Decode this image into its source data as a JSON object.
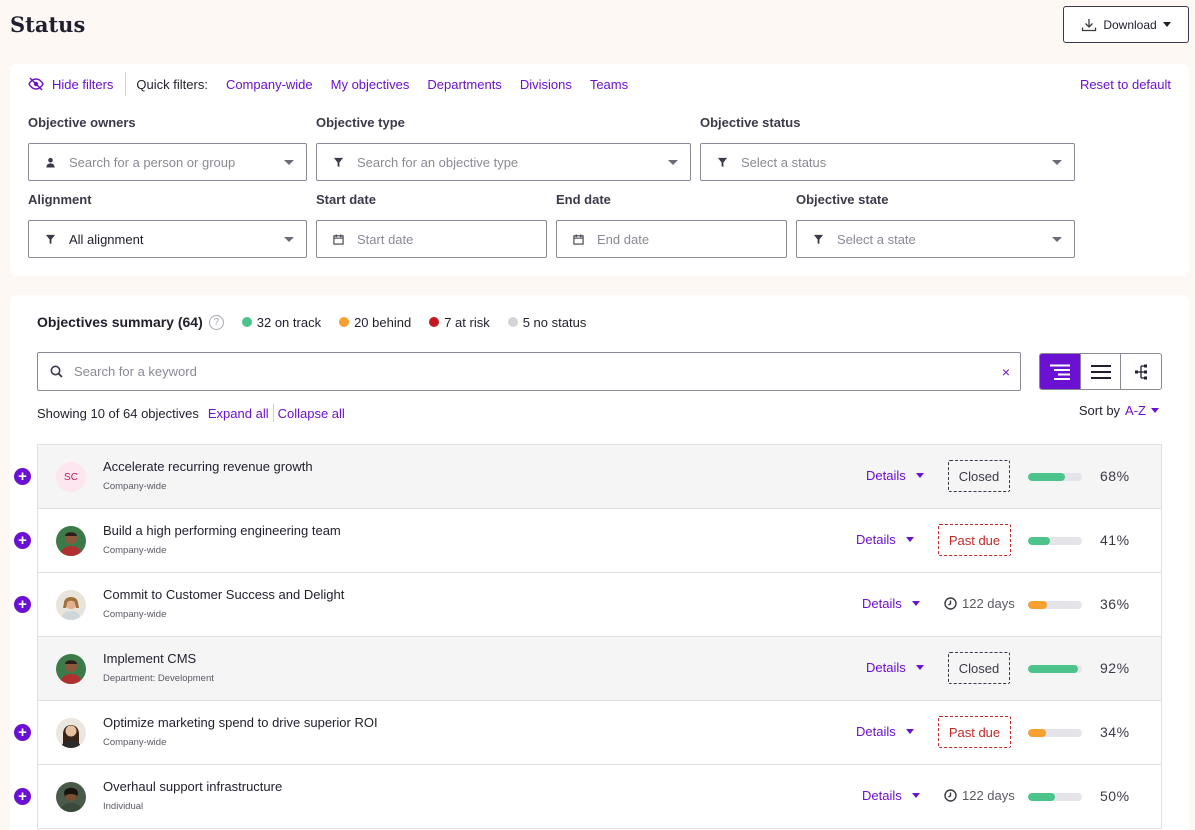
{
  "header": {
    "title": "Status",
    "download_label": "Download"
  },
  "filters": {
    "hide_label": "Hide filters",
    "quick_label": "Quick filters:",
    "quick_links": [
      "Company-wide",
      "My objectives",
      "Departments",
      "Divisions",
      "Teams"
    ],
    "reset_label": "Reset to default",
    "owners": {
      "label": "Objective owners",
      "placeholder": "Search for a person or group"
    },
    "type": {
      "label": "Objective type",
      "placeholder": "Search for an objective type"
    },
    "status": {
      "label": "Objective status",
      "placeholder": "Select a status"
    },
    "alignment": {
      "label": "Alignment",
      "value": "All alignment"
    },
    "start_date": {
      "label": "Start date",
      "placeholder": "Start date"
    },
    "end_date": {
      "label": "End date",
      "placeholder": "End date"
    },
    "state": {
      "label": "Objective state",
      "placeholder": "Select a state"
    }
  },
  "summary": {
    "title": "Objectives summary (64)",
    "help": "?",
    "stats": [
      {
        "label": "32 on track",
        "color": "#4cc38a"
      },
      {
        "label": "20 behind",
        "color": "#f5a031"
      },
      {
        "label": "7 at risk",
        "color": "#c3171e"
      },
      {
        "label": "5 no status",
        "color": "#d3d3da"
      }
    ],
    "search_placeholder": "Search for a keyword",
    "clear": "×",
    "showing": "Showing 10 of 64 objectives",
    "expand_all": "Expand all",
    "collapse_all": "Collapse all",
    "sort_label": "Sort by",
    "sort_value": "A-Z"
  },
  "objectives": [
    {
      "title": "Accelerate recurring revenue growth",
      "sub": "Company-wide",
      "avatar": "SC",
      "details": "Details",
      "badge": "Closed",
      "badge_type": "closed",
      "progress": 0.68,
      "progress_color": "#4cc38a",
      "pct": "68%",
      "expandable": true,
      "shaded": true
    },
    {
      "title": "Build a high performing engineering team",
      "sub": "Company-wide",
      "avatar": "",
      "details": "Details",
      "badge": "Past due",
      "badge_type": "pastdue",
      "progress": 0.41,
      "progress_color": "#4cc38a",
      "pct": "41%",
      "expandable": true,
      "shaded": false
    },
    {
      "title": "Commit to Customer Success and Delight",
      "sub": "Company-wide",
      "avatar": "",
      "details": "Details",
      "badge": "122 days",
      "badge_type": "days",
      "progress": 0.36,
      "progress_color": "#f5a031",
      "pct": "36%",
      "expandable": true,
      "shaded": false
    },
    {
      "title": "Implement CMS",
      "sub": "Department: Development",
      "avatar": "",
      "details": "Details",
      "badge": "Closed",
      "badge_type": "closed",
      "progress": 0.92,
      "progress_color": "#4cc38a",
      "pct": "92%",
      "expandable": false,
      "shaded": true
    },
    {
      "title": "Optimize marketing spend to drive superior ROI",
      "sub": "Company-wide",
      "avatar": "",
      "details": "Details",
      "badge": "Past due",
      "badge_type": "pastdue",
      "progress": 0.34,
      "progress_color": "#f5a031",
      "pct": "34%",
      "expandable": true,
      "shaded": false
    },
    {
      "title": "Overhaul support infrastructure",
      "sub": "Individual",
      "avatar": "",
      "details": "Details",
      "badge": "122 days",
      "badge_type": "days",
      "progress": 0.5,
      "progress_color": "#4cc38a",
      "pct": "50%",
      "expandable": true,
      "shaded": false
    }
  ]
}
